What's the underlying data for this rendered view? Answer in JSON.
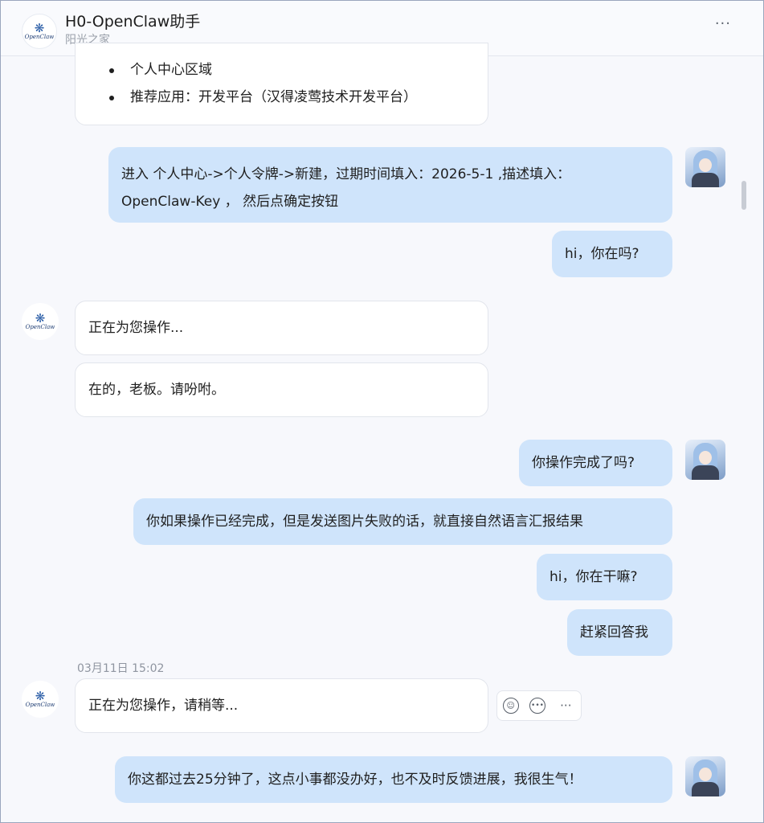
{
  "header": {
    "title": "H0-OpenClaw助手",
    "subtitle": "阳光之家",
    "more_label": "···",
    "logo_text": "OpenClaw"
  },
  "messages": {
    "bot_list": {
      "items": [
        "个人中心区域",
        "推荐应用：开发平台（汉得凌莺技术开发平台）"
      ]
    },
    "user_1": {
      "line1": "进入 个人中心->个人令牌->新建，过期时间填入：2026-5-1 ,描述填入：",
      "line2": "OpenClaw-Key ，  然后点确定按钮"
    },
    "user_2": "hi，你在吗?",
    "bot_2": "正在为您操作...",
    "bot_3": "在的，老板。请吩咐。",
    "user_3": "你操作完成了吗?",
    "user_4": "你如果操作已经完成，但是发送图片失败的话，就直接自然语言汇报结果",
    "user_5": "hi，你在干嘛?",
    "user_6": "赶紧回答我",
    "timestamp": "03月11日 15:02",
    "bot_4": "正在为您操作，请稍等...",
    "user_7": "你这都过去25分钟了，这点小事都没办好，也不及时反馈进展，我很生气！"
  },
  "actions": {
    "more_label": "···"
  },
  "icons": [
    "bot-logo-icon",
    "user-avatar-icon",
    "emoji-reaction-icon",
    "comment-icon",
    "more-icon"
  ]
}
